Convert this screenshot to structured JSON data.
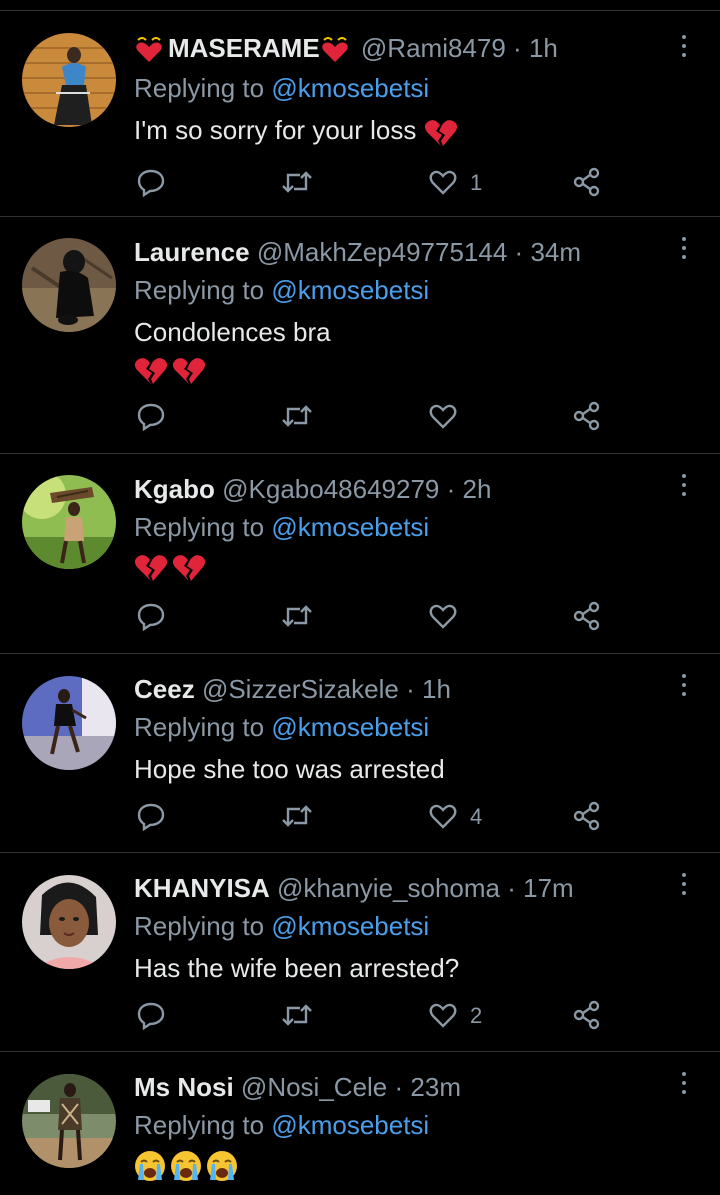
{
  "replying_prefix": "Replying to",
  "tweets": [
    {
      "name": "MASERAME",
      "name_decor": "heart-with-halo-emoji",
      "handle": "@Rami8479",
      "sep": "·",
      "time": "1h",
      "mention": "@kmosebetsi",
      "text": "I'm so sorry for your loss",
      "text_emoji": "broken-heart-emoji",
      "likes": "1",
      "retweets": "",
      "avatar_icon": "avatar-woman-brick-wall"
    },
    {
      "name": "Laurence",
      "handle": "@MakhZep49775144",
      "sep": "·",
      "time": "34m",
      "mention": "@kmosebetsi",
      "text": "Condolences bra",
      "emoji_line": [
        "broken-heart-emoji",
        "broken-heart-emoji"
      ],
      "likes": "",
      "avatar_icon": "avatar-black-dog"
    },
    {
      "name": "Kgabo",
      "handle": "@Kgabo48649279",
      "sep": "·",
      "time": "2h",
      "mention": "@kmosebetsi",
      "emoji_line": [
        "broken-heart-emoji",
        "broken-heart-emoji"
      ],
      "likes": "",
      "avatar_icon": "avatar-person-carrying-wood"
    },
    {
      "name": "Ceez",
      "handle": "@SizzerSizakele",
      "sep": "·",
      "time": "1h",
      "mention": "@kmosebetsi",
      "text": "Hope she too was arrested",
      "likes": "4",
      "avatar_icon": "avatar-woman-posing"
    },
    {
      "name": "KHANYISA",
      "handle": "@khanyie_sohoma",
      "sep": "·",
      "time": "17m",
      "mention": "@kmosebetsi",
      "text": "Has the wife been arrested?",
      "likes": "2",
      "avatar_icon": "avatar-woman-selfie"
    },
    {
      "name": "Ms Nosi",
      "handle": "@Nosi_Cele",
      "sep": "·",
      "time": "23m",
      "mention": "@kmosebetsi",
      "emoji_line": [
        "crying-face-emoji",
        "crying-face-emoji",
        "crying-face-emoji"
      ],
      "avatar_icon": "avatar-woman-outdoors"
    }
  ],
  "colors": {
    "background": "#000000",
    "text": "#e7e9ea",
    "muted": "#8b98a5",
    "link": "#4a9eea",
    "divider": "#2f3336"
  },
  "icons": [
    "reply-icon",
    "retweet-icon",
    "like-icon",
    "share-icon",
    "more-options-icon"
  ]
}
